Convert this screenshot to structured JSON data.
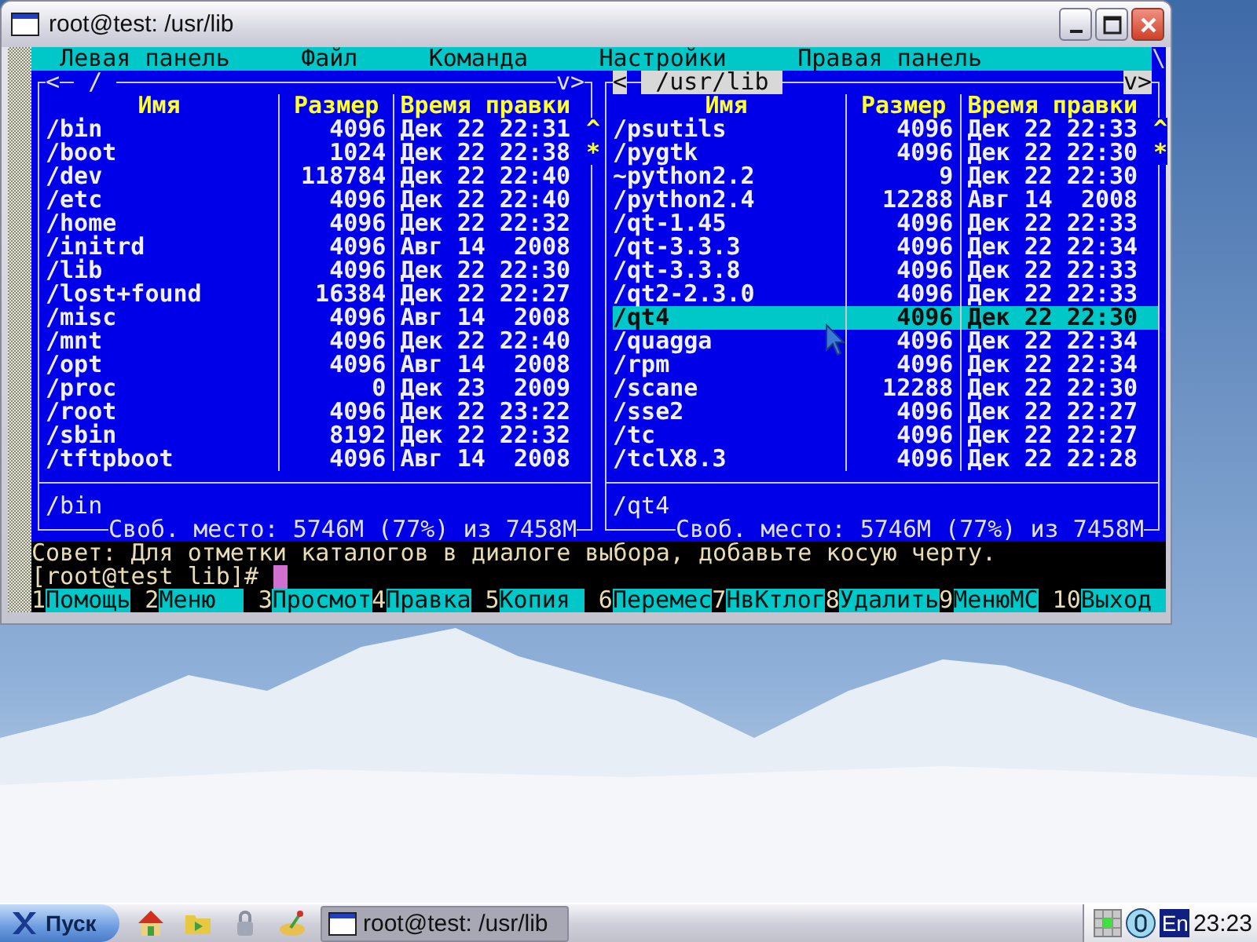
{
  "window": {
    "title": "root@test: /usr/lib"
  },
  "menu_bar": {
    "items": [
      "Левая панель",
      "Файл",
      "Команда",
      "Настройки",
      "Правая панель"
    ],
    "corner": "\\"
  },
  "panels": [
    {
      "active": false,
      "nav_left": "<",
      "title": "/",
      "nav_right": "v>",
      "columns": [
        "Имя",
        "Размер",
        "Время правки"
      ],
      "scroll_marks": [
        "^",
        "*"
      ],
      "rows": [
        {
          "name": "/bin",
          "size": "4096",
          "time": "Дек 22 22:31",
          "selected": false
        },
        {
          "name": "/boot",
          "size": "1024",
          "time": "Дек 22 22:38",
          "selected": false
        },
        {
          "name": "/dev",
          "size": "118784",
          "time": "Дек 22 22:40",
          "selected": false
        },
        {
          "name": "/etc",
          "size": "4096",
          "time": "Дек 22 22:40",
          "selected": false
        },
        {
          "name": "/home",
          "size": "4096",
          "time": "Дек 22 22:32",
          "selected": false
        },
        {
          "name": "/initrd",
          "size": "4096",
          "time": "Авг 14  2008",
          "selected": false
        },
        {
          "name": "/lib",
          "size": "4096",
          "time": "Дек 22 22:30",
          "selected": false
        },
        {
          "name": "/lost+found",
          "size": "16384",
          "time": "Дек 22 22:27",
          "selected": false
        },
        {
          "name": "/misc",
          "size": "4096",
          "time": "Авг 14  2008",
          "selected": false
        },
        {
          "name": "/mnt",
          "size": "4096",
          "time": "Дек 22 22:40",
          "selected": false
        },
        {
          "name": "/opt",
          "size": "4096",
          "time": "Авг 14  2008",
          "selected": false
        },
        {
          "name": "/proc",
          "size": "0",
          "time": "Дек 23  2009",
          "selected": false
        },
        {
          "name": "/root",
          "size": "4096",
          "time": "Дек 22 23:22",
          "selected": false
        },
        {
          "name": "/sbin",
          "size": "8192",
          "time": "Дек 22 22:32",
          "selected": false
        },
        {
          "name": "/tftpboot",
          "size": "4096",
          "time": "Авг 14  2008",
          "selected": false
        }
      ],
      "current_path": "/bin",
      "free_space": "Своб. место: 5746M (77%) из 7458M"
    },
    {
      "active": true,
      "nav_left": "<",
      "title": "/usr/lib",
      "nav_right": "v>",
      "columns": [
        "Имя",
        "Размер",
        "Время правки"
      ],
      "scroll_marks": [
        "^",
        "*"
      ],
      "rows": [
        {
          "name": "/psutils",
          "size": "4096",
          "time": "Дек 22 22:33",
          "selected": false
        },
        {
          "name": "/pygtk",
          "size": "4096",
          "time": "Дек 22 22:30",
          "selected": false
        },
        {
          "name": "~python2.2",
          "size": "9",
          "time": "Дек 22 22:30",
          "selected": false
        },
        {
          "name": "/python2.4",
          "size": "12288",
          "time": "Авг 14  2008",
          "selected": false
        },
        {
          "name": "/qt-1.45",
          "size": "4096",
          "time": "Дек 22 22:33",
          "selected": false
        },
        {
          "name": "/qt-3.3.3",
          "size": "4096",
          "time": "Дек 22 22:34",
          "selected": false
        },
        {
          "name": "/qt-3.3.8",
          "size": "4096",
          "time": "Дек 22 22:33",
          "selected": false
        },
        {
          "name": "/qt2-2.3.0",
          "size": "4096",
          "time": "Дек 22 22:33",
          "selected": false
        },
        {
          "name": "/qt4",
          "size": "4096",
          "time": "Дек 22 22:30",
          "selected": true
        },
        {
          "name": "/quagga",
          "size": "4096",
          "time": "Дек 22 22:34",
          "selected": false
        },
        {
          "name": "/rpm",
          "size": "4096",
          "time": "Дек 22 22:34",
          "selected": false
        },
        {
          "name": "/scane",
          "size": "12288",
          "time": "Дек 22 22:30",
          "selected": false
        },
        {
          "name": "/sse2",
          "size": "4096",
          "time": "Дек 22 22:27",
          "selected": false
        },
        {
          "name": "/tc",
          "size": "4096",
          "time": "Дек 22 22:27",
          "selected": false
        },
        {
          "name": "/tclX8.3",
          "size": "4096",
          "time": "Дек 22 22:28",
          "selected": false
        }
      ],
      "current_path": "/qt4",
      "free_space": "Своб. место: 5746M (77%) из 7458M"
    }
  ],
  "hint": "Совет: Для отметки каталогов в диалоге выбора, добавьте косую черту.",
  "prompt": "[root@test lib]#",
  "key_bar": [
    {
      "key": "1",
      "label": "Помощь"
    },
    {
      "key": "2",
      "label": "Меню"
    },
    {
      "key": "3",
      "label": "Просмот"
    },
    {
      "key": "4",
      "label": "Правка"
    },
    {
      "key": "5",
      "label": "Копия"
    },
    {
      "key": "6",
      "label": "Перемес"
    },
    {
      "key": "7",
      "label": "НвКтлог"
    },
    {
      "key": "8",
      "label": "Удалить"
    },
    {
      "key": "9",
      "label": "МенюМС"
    },
    {
      "key": "10",
      "label": "Выход"
    }
  ],
  "taskbar": {
    "start": "Пуск",
    "tasks": [
      {
        "title": "root@test: /usr/lib",
        "selected": true
      }
    ],
    "language": "En",
    "clock": "23:23"
  }
}
